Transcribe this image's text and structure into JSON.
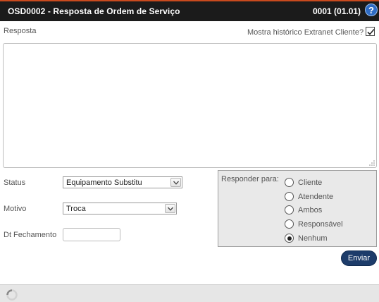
{
  "window": {
    "title": "OSD0002 - Resposta de Ordem de Serviço",
    "version": "0001 (01.01)",
    "help_label": "?"
  },
  "form": {
    "resposta_label": "Resposta",
    "history_label": "Mostra histórico Extranet Cliente?",
    "history_checked": true,
    "resposta_value": "",
    "status_label": "Status",
    "status_value": "Equipamento Substitu",
    "motivo_label": "Motivo",
    "motivo_value": "Troca",
    "dt_fechamento_label": "Dt Fechamento",
    "dt_fechamento_value": ""
  },
  "responder": {
    "label": "Responder para:",
    "options": [
      {
        "label": "Cliente",
        "checked": false
      },
      {
        "label": "Atendente",
        "checked": false
      },
      {
        "label": "Ambos",
        "checked": false
      },
      {
        "label": "Responsável",
        "checked": false
      },
      {
        "label": "Nenhum",
        "checked": true
      }
    ]
  },
  "actions": {
    "send_label": "Enviar"
  },
  "colors": {
    "titlebar": "#1b1b1b",
    "title_accent": "#c94a1e",
    "help": "#2f6cc4",
    "send_button": "#1d3c6a",
    "panel": "#e9e9e9"
  },
  "icons": {
    "help": "question-circle-icon",
    "check": "checkmark-icon",
    "dropdown": "chevron-down-icon",
    "resize": "resize-grip-icon",
    "loading": "spinner-icon"
  }
}
